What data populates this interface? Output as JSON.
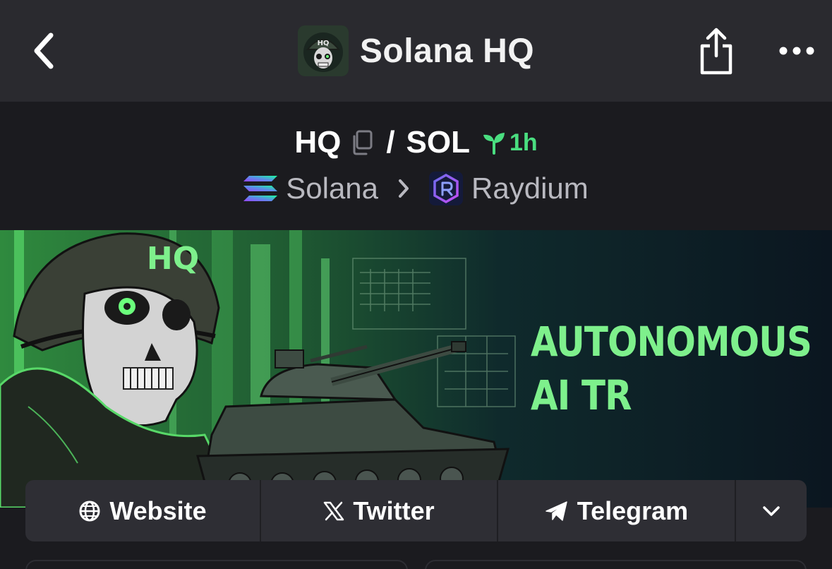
{
  "header": {
    "title": "Solana HQ",
    "avatar_text": "HQ"
  },
  "pair": {
    "base": "HQ",
    "separator": "/",
    "quote": "SOL",
    "age": "1h",
    "age_color": "#4ade80"
  },
  "breadcrumb": {
    "chain": "Solana",
    "dex": "Raydium"
  },
  "banner": {
    "tag": "HQ",
    "line1": "AUTONOMOUS",
    "line2": "AI TR"
  },
  "links": {
    "website": "Website",
    "twitter": "Twitter",
    "telegram": "Telegram"
  },
  "colors": {
    "header_bg": "#2a2a2f",
    "page_bg": "#1b1b1f",
    "accent_green": "#4ade80",
    "banner_green": "#7ef08c"
  }
}
